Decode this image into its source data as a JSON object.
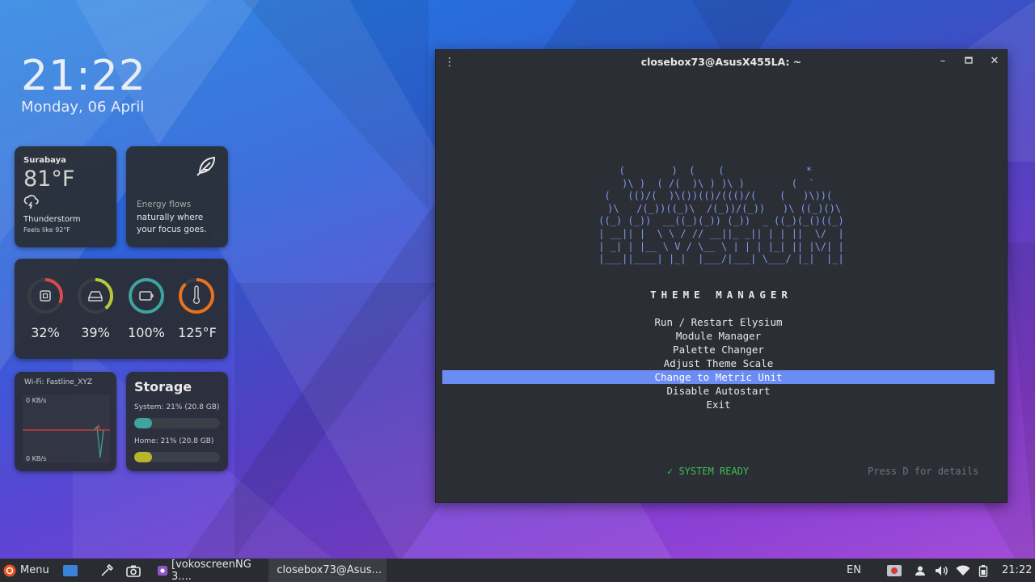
{
  "clock": {
    "time": "21:22",
    "date": "Monday, 06 April"
  },
  "weather": {
    "city": "Surabaya",
    "temp": "81°F",
    "condition": "Thunderstorm",
    "feels_like": "Feels like 92°F"
  },
  "quote": {
    "line1": "Energy flows",
    "line2": "naturally where",
    "line3": "your focus goes."
  },
  "stats": [
    {
      "icon": "cpu-icon",
      "value": "32%",
      "fraction": 0.32,
      "color": "#d94a4a"
    },
    {
      "icon": "disk-icon",
      "value": "39%",
      "fraction": 0.39,
      "color": "#b7c83a"
    },
    {
      "icon": "battery-icon",
      "value": "100%",
      "fraction": 1.0,
      "color": "#3fa3a0"
    },
    {
      "icon": "thermometer-icon",
      "value": "125°F",
      "fraction": 0.88,
      "color": "#e8731f"
    }
  ],
  "network": {
    "ssid": "Wi-Fi: Fastline_XYZ",
    "top_label": "0 KB/s",
    "bottom_label": "0 KB/s"
  },
  "storage": {
    "title": "Storage",
    "system_label": "System: 21% (20.8 GB)",
    "system_fraction": 0.21,
    "system_color": "#3fa3a0",
    "home_label": "Home: 21% (20.8 GB)",
    "home_fraction": 0.21,
    "home_color": "#b7b62a"
  },
  "terminal": {
    "title": "closebox73@AsusX455LA: ~",
    "ascii_art": "(        )  (    (              *  \n )\\ )  ( /(  )\\ ) )\\ )        (  `  \n(   (()/(  )\\())(()/((()/(    (   )\\))( \n )\\   /(_))((_)\\  /(_))/(_))   )\\ ((_)()\\\n((_) (_))  __((_)(_)) (_))  _ ((_)(_()((_)\n| __|| |  \\ \\ / // __||_ _|| | | ||  \\/  |\n| _| | |__ \\ V / \\__ \\ | | | |_| || |\\/| |\n|___||____| |_|  |___/|___| \\___/ |_|  |_|",
    "heading": "THEME MANAGER",
    "menu": [
      {
        "label": "Run / Restart Elysium",
        "selected": false
      },
      {
        "label": "Module Manager",
        "selected": false
      },
      {
        "label": "Palette Changer",
        "selected": false
      },
      {
        "label": "Adjust Theme Scale",
        "selected": false
      },
      {
        "label": "Change to Metric Unit",
        "selected": true
      },
      {
        "label": "Disable Autostart",
        "selected": false
      },
      {
        "label": "Exit",
        "selected": false
      }
    ],
    "status_ready": "✓ SYSTEM READY",
    "status_hint": "Press D for details",
    "accent_color": "#6b8cf2"
  },
  "taskbar": {
    "menu_label": "Menu",
    "apps": [
      {
        "label": "[vokoscreenNG 3....",
        "active": false
      },
      {
        "label": "closebox73@Asus...",
        "active": true
      }
    ],
    "keyboard_layout": "EN",
    "time": "21:22"
  }
}
